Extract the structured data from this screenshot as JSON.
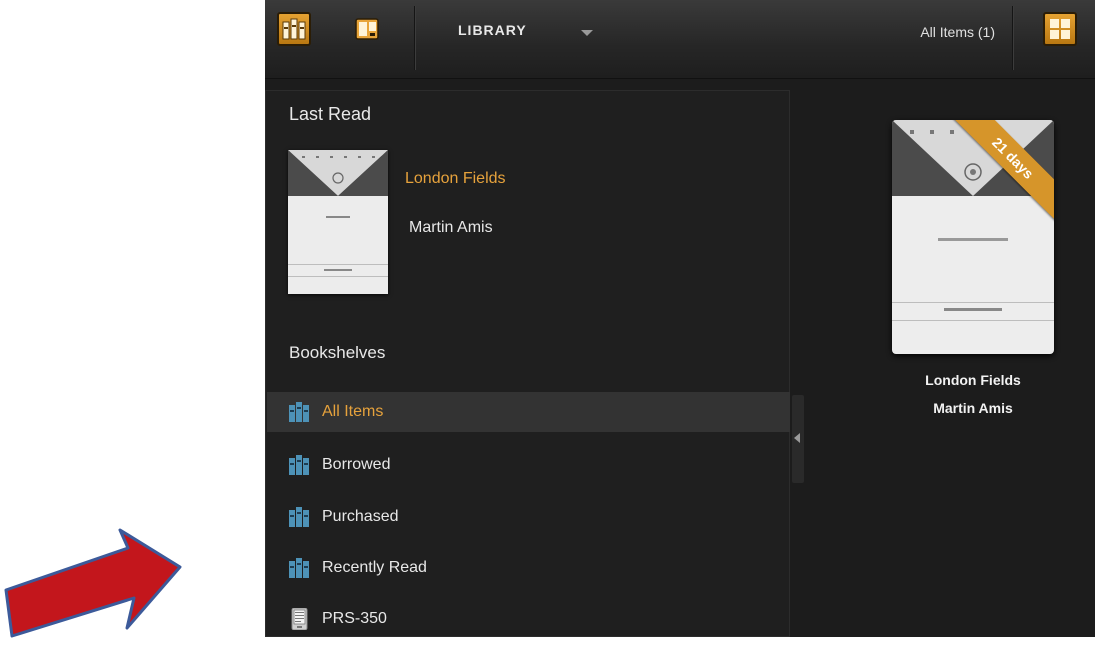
{
  "toolbar": {
    "library_label": "LIBRARY",
    "filter_label": "All Items  (1)",
    "buttons": [
      "bookshelf-view",
      "thumbnail-view",
      "grid-view"
    ]
  },
  "last_read": {
    "heading": "Last Read",
    "title": "London Fields",
    "author": "Martin Amis"
  },
  "bookshelves": {
    "heading": "Bookshelves",
    "items": [
      {
        "label": "All Items",
        "icon": "bookshelf-icon",
        "selected": true
      },
      {
        "label": "Borrowed",
        "icon": "bookshelf-icon"
      },
      {
        "label": "Purchased",
        "icon": "bookshelf-icon"
      },
      {
        "label": "Recently Read",
        "icon": "bookshelf-icon"
      },
      {
        "label": "PRS-350",
        "icon": "ereader-device-icon"
      }
    ]
  },
  "grid": {
    "books": [
      {
        "title": "London Fields",
        "author": "Martin Amis",
        "ribbon": "21 days"
      }
    ]
  },
  "colors": {
    "accent": "#e6a23c",
    "arrow": "#c3161c"
  }
}
